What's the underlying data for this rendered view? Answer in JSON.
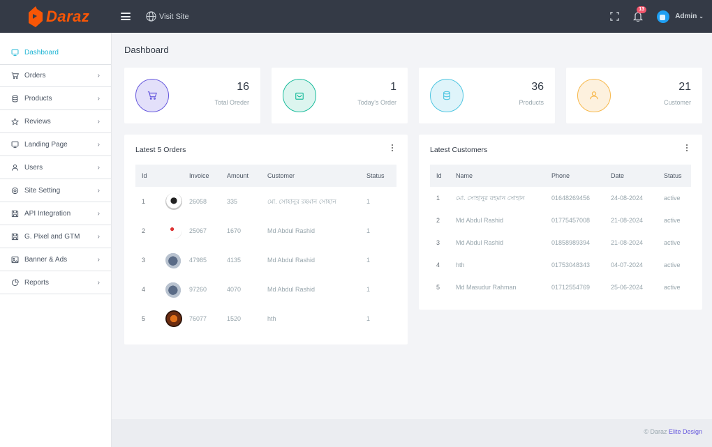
{
  "brand": {
    "name": "Daraz",
    "color": "#f85606"
  },
  "topbar": {
    "visit_label": "Visit Site",
    "notification_count": "13",
    "user_name": "Admin"
  },
  "page_title": "Dashboard",
  "sidebar": {
    "items": [
      {
        "label": "Dashboard",
        "icon": "monitor-icon",
        "active": true
      },
      {
        "label": "Orders",
        "icon": "cart-icon"
      },
      {
        "label": "Products",
        "icon": "database-icon"
      },
      {
        "label": "Reviews",
        "icon": "star-icon"
      },
      {
        "label": "Landing Page",
        "icon": "monitor-icon"
      },
      {
        "label": "Users",
        "icon": "user-icon"
      },
      {
        "label": "Site Setting",
        "icon": "gear-icon"
      },
      {
        "label": "API Integration",
        "icon": "save-icon"
      },
      {
        "label": "G. Pixel and GTM",
        "icon": "save-icon"
      },
      {
        "label": "Banner & Ads",
        "icon": "image-icon"
      },
      {
        "label": "Reports",
        "icon": "pie-chart-icon"
      }
    ]
  },
  "stats": [
    {
      "value": "16",
      "label": "Total Oreder",
      "color": "#6658dd",
      "bg": "#d5d1f7"
    },
    {
      "value": "1",
      "label": "Today's Order",
      "color": "#1abc9c",
      "bg": "#d3f3ec"
    },
    {
      "value": "36",
      "label": "Products",
      "color": "#4fc6e1",
      "bg": "#d9f3f9"
    },
    {
      "value": "21",
      "label": "Customer",
      "color": "#f7b84b",
      "bg": "#fdefd9"
    }
  ],
  "orders": {
    "title": "Latest 5 Orders",
    "headers": [
      "Id",
      "",
      "Invoice",
      "Amount",
      "Customer",
      "Status"
    ],
    "rows": [
      {
        "id": "1",
        "invoice": "26058",
        "amount": "335",
        "customer": "মো. সোহানুর রহমান সোহান",
        "status": "1"
      },
      {
        "id": "2",
        "invoice": "25067",
        "amount": "1670",
        "customer": "Md Abdul Rashid",
        "status": "1"
      },
      {
        "id": "3",
        "invoice": "47985",
        "amount": "4135",
        "customer": "Md Abdul Rashid",
        "status": "1"
      },
      {
        "id": "4",
        "invoice": "97260",
        "amount": "4070",
        "customer": "Md Abdul Rashid",
        "status": "1"
      },
      {
        "id": "5",
        "invoice": "76077",
        "amount": "1520",
        "customer": "hth",
        "status": "1"
      }
    ]
  },
  "customers": {
    "title": "Latest Customers",
    "headers": [
      "Id",
      "Name",
      "Phone",
      "Date",
      "Status"
    ],
    "rows": [
      {
        "id": "1",
        "name": "মো. সোহানুর রহমান সোহান",
        "phone": "01648269456",
        "date": "24-08-2024",
        "status": "active"
      },
      {
        "id": "2",
        "name": "Md Abdul Rashid",
        "phone": "01775457008",
        "date": "21-08-2024",
        "status": "active"
      },
      {
        "id": "3",
        "name": "Md Abdul Rashid",
        "phone": "01858989394",
        "date": "21-08-2024",
        "status": "active"
      },
      {
        "id": "4",
        "name": "hth",
        "phone": "01753048343",
        "date": "04-07-2024",
        "status": "active"
      },
      {
        "id": "5",
        "name": "Md Masudur Rahman",
        "phone": "01712554769",
        "date": "25-06-2024",
        "status": "active"
      }
    ]
  },
  "footer": {
    "copyright": "© Daraz",
    "link": "Elite Design"
  }
}
